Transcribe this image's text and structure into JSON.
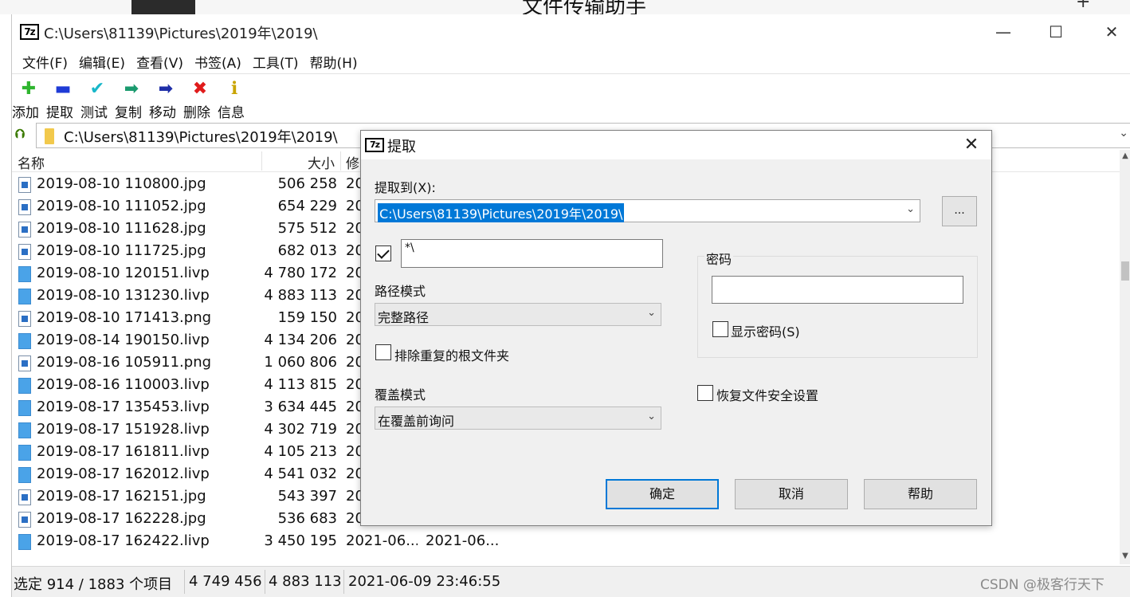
{
  "colors": {
    "accent": "#0078d7",
    "dialog_bg": "#f0f0f0",
    "add_green": "#2fb52f",
    "extract_blue": "#1f3bd6",
    "delete_red": "#e01b1b"
  },
  "background": {
    "right_title": "文件传输助手",
    "plus_icon": "+"
  },
  "window": {
    "app_icon": "7z",
    "title": "C:\\Users\\81139\\Pictures\\2019年\\2019\\",
    "buttons": {
      "minimize": "—",
      "maximize": "☐",
      "close": "✕"
    }
  },
  "menu": [
    "文件(F)",
    "编辑(E)",
    "查看(V)",
    "书签(A)",
    "工具(T)",
    "帮助(H)"
  ],
  "toolbar": [
    {
      "label": "添加",
      "icon": "add-icon",
      "glyph": "✚",
      "color": "#2fb52f"
    },
    {
      "label": "提取",
      "icon": "extract-icon",
      "glyph": "▬",
      "color": "#1f3bd6"
    },
    {
      "label": "测试",
      "icon": "test-icon",
      "glyph": "✔",
      "color": "#18b7c9"
    },
    {
      "label": "复制",
      "icon": "copy-icon",
      "glyph": "➡",
      "color": "#1a9a6e"
    },
    {
      "label": "移动",
      "icon": "move-icon",
      "glyph": "➡",
      "color": "#1f2fa8"
    },
    {
      "label": "删除",
      "icon": "delete-icon",
      "glyph": "✖",
      "color": "#e01b1b"
    },
    {
      "label": "信息",
      "icon": "info-icon",
      "glyph": "ℹ",
      "color": "#c9a400"
    }
  ],
  "address": {
    "path": "C:\\Users\\81139\\Pictures\\2019年\\2019\\"
  },
  "columns": {
    "name": "名称",
    "size": "大小",
    "modified": "修"
  },
  "files": [
    {
      "name": "2019-08-10 110800.jpg",
      "size": "506 258",
      "modified": "20",
      "type": "img"
    },
    {
      "name": "2019-08-10 111052.jpg",
      "size": "654 229",
      "modified": "20",
      "type": "img"
    },
    {
      "name": "2019-08-10 111628.jpg",
      "size": "575 512",
      "modified": "20",
      "type": "img"
    },
    {
      "name": "2019-08-10 111725.jpg",
      "size": "682 013",
      "modified": "20",
      "type": "img"
    },
    {
      "name": "2019-08-10 120151.livp",
      "size": "4 780 172",
      "modified": "20",
      "type": "doc"
    },
    {
      "name": "2019-08-10 131230.livp",
      "size": "4 883 113",
      "modified": "20",
      "type": "doc"
    },
    {
      "name": "2019-08-10 171413.png",
      "size": "159 150",
      "modified": "20",
      "type": "img"
    },
    {
      "name": "2019-08-14 190150.livp",
      "size": "4 134 206",
      "modified": "20",
      "type": "doc"
    },
    {
      "name": "2019-08-16 105911.png",
      "size": "1 060 806",
      "modified": "20",
      "type": "img"
    },
    {
      "name": "2019-08-16 110003.livp",
      "size": "4 113 815",
      "modified": "20",
      "type": "doc"
    },
    {
      "name": "2019-08-17 135453.livp",
      "size": "3 634 445",
      "modified": "20",
      "type": "doc"
    },
    {
      "name": "2019-08-17 151928.livp",
      "size": "4 302 719",
      "modified": "20",
      "type": "doc"
    },
    {
      "name": "2019-08-17 161811.livp",
      "size": "4 105 213",
      "modified": "20",
      "type": "doc"
    },
    {
      "name": "2019-08-17 162012.livp",
      "size": "4 541 032",
      "modified": "20",
      "type": "doc"
    },
    {
      "name": "2019-08-17 162151.jpg",
      "size": "543 397",
      "modified": "20",
      "type": "img"
    },
    {
      "name": "2019-08-17 162228.jpg",
      "size": "536 683",
      "modified": "20",
      "type": "img"
    },
    {
      "name": "2019-08-17 162422.livp",
      "size": "3 450 195",
      "modified": "2021-06...",
      "created": "2021-06...",
      "type": "doc"
    }
  ],
  "status": {
    "selection": "选定 914 / 1883 个项目",
    "total_size": "4 749 456",
    "item_size": "4 883 113",
    "date": "2021-06-09 23:46:55"
  },
  "watermark": "CSDN @极客行天下",
  "dialog": {
    "icon": "7z",
    "title": "提取",
    "close": "✕",
    "extract_to_label": "提取到(X):",
    "extract_to_value": "C:\\Users\\81139\\Pictures\\2019年\\2019\\",
    "browse_label": "...",
    "subfolder_checked": true,
    "subfolder_value": "*\\",
    "path_mode_label": "路径模式",
    "path_mode_value": "完整路径",
    "exclude_root_label": "排除重复的根文件夹",
    "exclude_root_checked": false,
    "overwrite_label": "覆盖模式",
    "overwrite_value": "在覆盖前询问",
    "password_label": "密码",
    "password_value": "",
    "show_password_label": "显示密码(S)",
    "show_password_checked": false,
    "restore_security_label": "恢复文件安全设置",
    "restore_security_checked": false,
    "ok": "确定",
    "cancel": "取消",
    "help": "帮助"
  }
}
